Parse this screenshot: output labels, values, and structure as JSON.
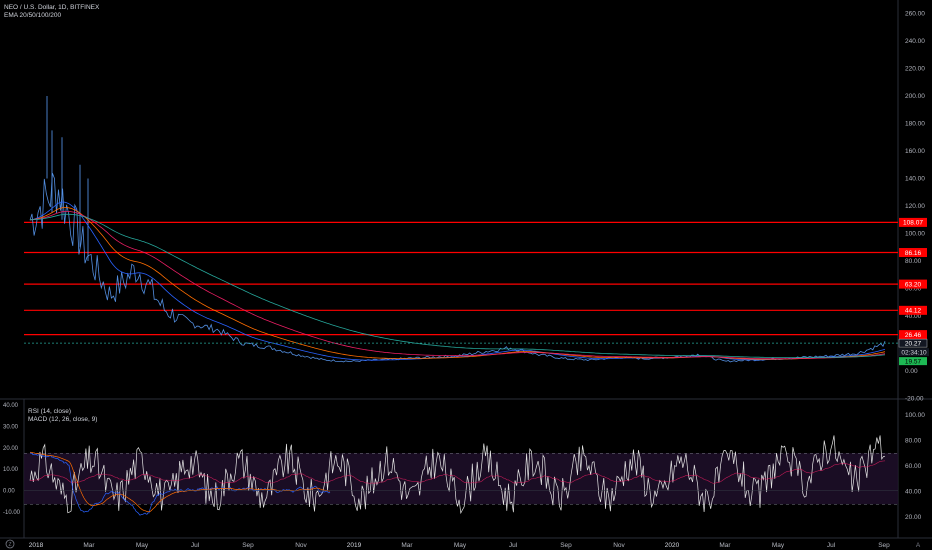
{
  "header": {
    "symbol_title": "NEO / U.S. Dollar, 1D, BITFINEX",
    "indicator_ema": "EMA 20/50/100/200"
  },
  "lower_pane": {
    "indicator_rsi": "RSI (14, close)",
    "indicator_macd": "MACD (12, 26, close, 9)"
  },
  "price_axis": {
    "ticks": [
      "260.00",
      "240.00",
      "220.00",
      "200.00",
      "180.00",
      "160.00",
      "140.00",
      "120.00",
      "100.00",
      "80.00",
      "60.00",
      "40.00",
      "20.00",
      "0.00",
      "-20.00"
    ]
  },
  "rsi_axis": {
    "ticks": [
      "100.00",
      "80.00",
      "60.00",
      "40.00",
      "20.00"
    ]
  },
  "macd_axis": {
    "ticks": [
      "40.00",
      "30.00",
      "20.00",
      "10.00",
      "0.00",
      "-10.00"
    ]
  },
  "time_axis": {
    "labels": [
      "2018",
      "Mar",
      "May",
      "Jul",
      "Sep",
      "Nov",
      "2019",
      "Mar",
      "May",
      "Jul",
      "Sep",
      "Nov",
      "2020",
      "Mar",
      "May",
      "Jul",
      "Sep"
    ]
  },
  "horizontal_levels": {
    "values": [
      108.07,
      86.16,
      63.2,
      44.12,
      26.46
    ],
    "labels": [
      "108.07",
      "86.16",
      "63.20",
      "44.12",
      "26.46"
    ],
    "color": "#ff0000"
  },
  "price_badges": {
    "last_price": "20.27",
    "countdown": "02:34:10",
    "ema_value": "19.57"
  },
  "bottom_bar": {
    "left_icon": "zoom-icon",
    "right_label": "A"
  },
  "colors": {
    "background": "#000000",
    "candle": "#5b9cf6",
    "level_line": "#ff0000",
    "ema20": "#2962ff",
    "ema50": "#ff6d00",
    "ema100": "#e91e63",
    "ema200": "#26a69a",
    "rsi_line": "#e6e6e6",
    "rsi_band": "#1e0f2a",
    "badge_green": "#1db954"
  },
  "chart_data": {
    "type": "line",
    "title": "NEO / U.S. Dollar, 1D, BITFINEX",
    "x": [
      "2018-01",
      "2018-02",
      "2018-03",
      "2018-04",
      "2018-05",
      "2018-06",
      "2018-07",
      "2018-08",
      "2018-09",
      "2018-10",
      "2018-11",
      "2018-12",
      "2019-01",
      "2019-02",
      "2019-03",
      "2019-04",
      "2019-05",
      "2019-06",
      "2019-07",
      "2019-08",
      "2019-09",
      "2019-10",
      "2019-11",
      "2019-12",
      "2020-01",
      "2020-02",
      "2020-03",
      "2020-04",
      "2020-05",
      "2020-06",
      "2020-07",
      "2020-08",
      "2020-09"
    ],
    "series": [
      {
        "name": "",
        "values": [
          110,
          135,
          90,
          55,
          75,
          45,
          35,
          30,
          20,
          17,
          12,
          8,
          7,
          8,
          9,
          10,
          11,
          14,
          17,
          12,
          9,
          8,
          10,
          9,
          10,
          12,
          7,
          8,
          9,
          10,
          11,
          13,
          20
        ]
      }
    ],
    "ylim": [
      -25,
      265
    ],
    "horizontal_lines": [
      108.07,
      86.16,
      63.2,
      44.12,
      26.46
    ],
    "legend_position": "none",
    "grid": false
  }
}
